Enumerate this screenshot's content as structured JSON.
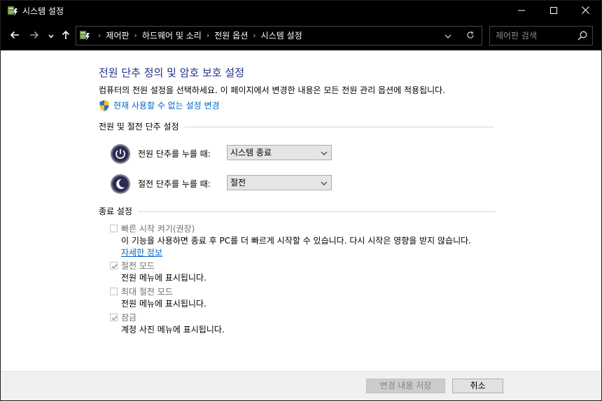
{
  "window": {
    "title": "시스템 설정",
    "icon": "power-options-icon"
  },
  "nav": {
    "breadcrumb": [
      "제어판",
      "하드웨어 및 소리",
      "전원 옵션",
      "시스템 설정"
    ],
    "search_placeholder": "제어판 검색"
  },
  "content": {
    "title": "전원 단추 정의 및 암호 보호 설정",
    "description": "컴퓨터의 전원 설정을 선택하세요. 이 페이지에서 변경한 내용은 모든 전원 관리 옵션에 적용됩니다.",
    "change_link": "현재 사용할 수 없는 설정 변경",
    "power_section": {
      "heading": "전원 및 절전 단추 설정",
      "rows": [
        {
          "label": "전원 단추를 누를 때:",
          "value": "시스템 종료",
          "icon": "power-button-icon"
        },
        {
          "label": "절전 단추를 누를 때:",
          "value": "절전",
          "icon": "sleep-button-icon"
        }
      ]
    },
    "shutdown_section": {
      "heading": "종료 설정",
      "items": [
        {
          "title": "빠른 시작 켜기(권장)",
          "checked": false,
          "description": "이 기능을 사용하면 종료 후 PC를 더 빠르게 시작할 수 있습니다. 다시 시작은 영향을 받지 않습니다.",
          "more_link": "자세한 정보"
        },
        {
          "title": "절전 모드",
          "checked": true,
          "description": "전원 메뉴에 표시됩니다."
        },
        {
          "title": "최대 절전 모드",
          "checked": false,
          "description": "전원 메뉴에 표시됩니다."
        },
        {
          "title": "잠금",
          "checked": true,
          "description": "계정 사진 메뉴에 표시됩니다."
        }
      ]
    }
  },
  "footer": {
    "save_label": "변경 내용 저장",
    "cancel_label": "취소"
  },
  "colors": {
    "title_blue": "#1e3287",
    "link_blue": "#0066cc",
    "titlebar_bg": "#000000"
  }
}
